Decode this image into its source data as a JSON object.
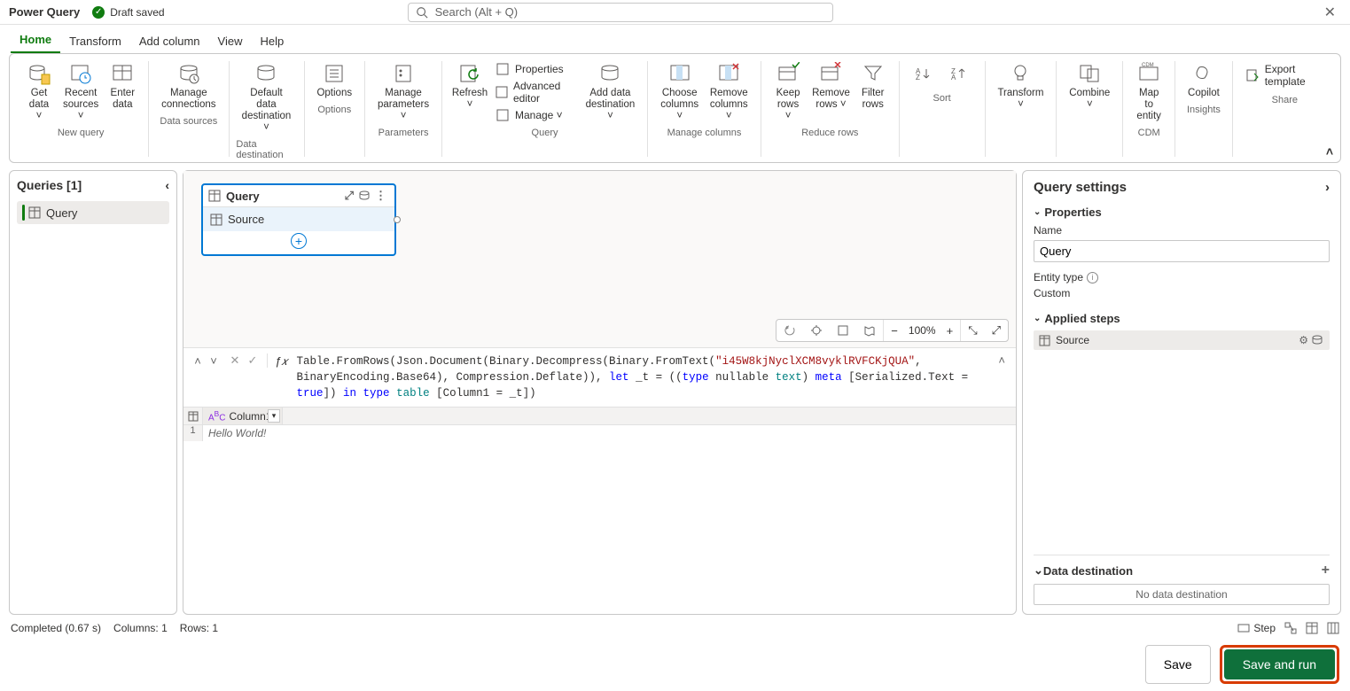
{
  "app": {
    "title": "Power Query",
    "status": "Draft saved"
  },
  "search": {
    "placeholder": "Search (Alt + Q)"
  },
  "tabs": [
    {
      "label": "Home",
      "active": true
    },
    {
      "label": "Transform"
    },
    {
      "label": "Add column"
    },
    {
      "label": "View"
    },
    {
      "label": "Help"
    }
  ],
  "ribbon": {
    "groups": {
      "new_query": {
        "label": "New query",
        "get_data": "Get\ndata ˅",
        "recent_sources": "Recent\nsources ˅",
        "enter_data": "Enter\ndata"
      },
      "data_sources": {
        "label": "Data sources",
        "manage_connections": "Manage\nconnections"
      },
      "data_destination": {
        "label": "Data destination",
        "default": "Default data\ndestination ˅"
      },
      "options": {
        "label": "Options",
        "options_btn": "Options"
      },
      "parameters": {
        "label": "Parameters",
        "manage": "Manage\nparameters ˅"
      },
      "query": {
        "label": "Query",
        "refresh": "Refresh\n˅",
        "properties": "Properties",
        "advanced": "Advanced editor",
        "manage": "Manage ˅",
        "add_dest": "Add data\ndestination ˅"
      },
      "manage_cols": {
        "label": "Manage columns",
        "choose": "Choose\ncolumns ˅",
        "remove": "Remove\ncolumns ˅"
      },
      "reduce_rows": {
        "label": "Reduce rows",
        "keep": "Keep\nrows ˅",
        "remove": "Remove\nrows ˅",
        "filter": "Filter\nrows"
      },
      "sort": {
        "label": "Sort"
      },
      "transform": {
        "label": "",
        "btn": "Transform\n˅"
      },
      "combine": {
        "label": "",
        "btn": "Combine\n˅"
      },
      "cdm": {
        "label": "CDM",
        "btn": "Map to\nentity"
      },
      "insights": {
        "label": "Insights",
        "btn": "Copilot"
      },
      "share": {
        "label": "Share",
        "btn": "Export template"
      }
    }
  },
  "queries": {
    "title": "Queries [1]",
    "items": [
      "Query"
    ]
  },
  "diagram": {
    "card_title": "Query",
    "step": "Source",
    "zoom": "100%"
  },
  "formula": {
    "pre1": "Table.FromRows(Json.Document(Binary.Decompress(Binary.FromText(",
    "str1": "\"i45W8kjNyclXCM8vyklRVFCKjQUA\"",
    "post1": ",",
    "line2a": "BinaryEncoding.Base64), Compression.Deflate)), ",
    "kw_let": "let",
    "mid2": " _t = ((",
    "kw_type1": "type",
    "mid2b": " nullable ",
    "ty_text": "text",
    "mid2c": ") ",
    "kw_meta": "meta",
    "mid2d": " [Serialized.Text = ",
    "kw_true": "true",
    "line3a": "]) ",
    "kw_in": "in",
    "line3b": " ",
    "kw_type2": "type",
    "line3c": " ",
    "ty_table": "table",
    "line3d": " [Column1 = _t])"
  },
  "grid": {
    "col1": "Column1",
    "rows": [
      {
        "n": "1",
        "cell": "Hello World!"
      }
    ]
  },
  "settings": {
    "title": "Query settings",
    "properties": "Properties",
    "name_label": "Name",
    "name_value": "Query",
    "entity_type_label": "Entity type",
    "entity_type_value": "Custom",
    "applied": "Applied steps",
    "step1": "Source",
    "dest": "Data destination",
    "no_dest": "No data destination"
  },
  "status": {
    "completed": "Completed (0.67 s)",
    "columns": "Columns: 1",
    "rows": "Rows: 1",
    "step_btn": "Step"
  },
  "footer": {
    "save": "Save",
    "save_run": "Save and run"
  }
}
